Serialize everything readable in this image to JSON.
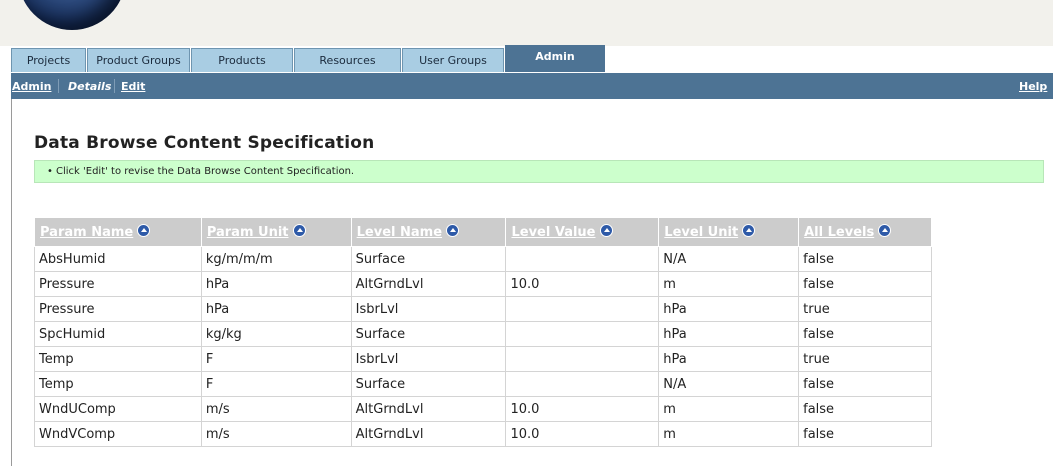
{
  "tabs": [
    {
      "label": "Projects",
      "active": false
    },
    {
      "label": "Product Groups",
      "active": false
    },
    {
      "label": "Products",
      "active": false
    },
    {
      "label": "Resources",
      "active": false
    },
    {
      "label": "User Groups",
      "active": false
    },
    {
      "label": "Admin",
      "active": true
    }
  ],
  "subnav": {
    "admin_label": "Admin",
    "details_label": "Details",
    "edit_label": "Edit",
    "help_label": "Help"
  },
  "page": {
    "title": "Data Browse Content Specification",
    "info_bullet": "•",
    "info_text": "Click 'Edit' to revise the Data Browse Content Specification."
  },
  "table": {
    "columns": [
      "Param Name",
      "Param Unit",
      "Level Name",
      "Level Value",
      "Level Unit",
      "All Levels"
    ],
    "rows": [
      [
        "AbsHumid",
        "kg/m/m/m",
        "Surface",
        "",
        "N/A",
        "false"
      ],
      [
        "Pressure",
        "hPa",
        "AltGrndLvl",
        "10.0",
        "m",
        "false"
      ],
      [
        "Pressure",
        "hPa",
        "IsbrLvl",
        "",
        "hPa",
        "true"
      ],
      [
        "SpcHumid",
        "kg/kg",
        "Surface",
        "",
        "hPa",
        "false"
      ],
      [
        "Temp",
        "F",
        "IsbrLvl",
        "",
        "hPa",
        "true"
      ],
      [
        "Temp",
        "F",
        "Surface",
        "",
        "N/A",
        "false"
      ],
      [
        "WndUComp",
        "m/s",
        "AltGrndLvl",
        "10.0",
        "m",
        "false"
      ],
      [
        "WndVComp",
        "m/s",
        "AltGrndLvl",
        "10.0",
        "m",
        "false"
      ]
    ]
  },
  "icons": {
    "logo": "globe-logo-icon",
    "sort": "sort-ascending-icon"
  },
  "colors": {
    "nav_bar": "#4d7394",
    "tab_inactive": "#a9cde3",
    "info_background": "#ccffcc",
    "table_header": "#cccccc",
    "sort_icon": "#2e5aa8"
  }
}
